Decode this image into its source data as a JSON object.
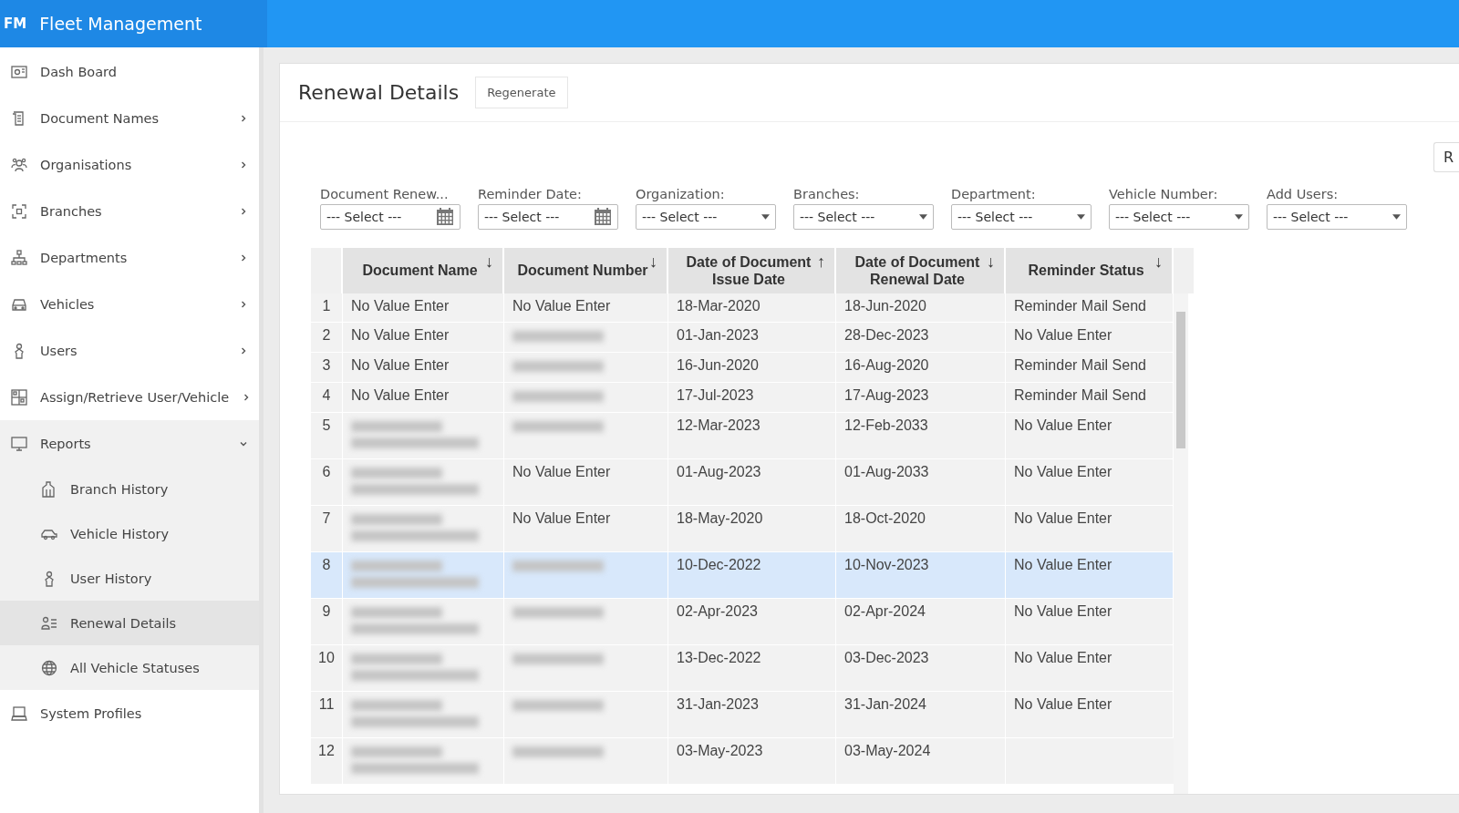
{
  "app": {
    "logo": "FM",
    "title": "Fleet Management"
  },
  "sidebar": {
    "items": [
      {
        "label": "Dash Board",
        "expandable": false,
        "expanded": false,
        "selected": false
      },
      {
        "label": "Document Names",
        "expandable": true,
        "expanded": false,
        "selected": false
      },
      {
        "label": "Organisations",
        "expandable": true,
        "expanded": false,
        "selected": false
      },
      {
        "label": "Branches",
        "expandable": true,
        "expanded": false,
        "selected": false
      },
      {
        "label": "Departments",
        "expandable": true,
        "expanded": false,
        "selected": false
      },
      {
        "label": "Vehicles",
        "expandable": true,
        "expanded": false,
        "selected": false
      },
      {
        "label": "Users",
        "expandable": true,
        "expanded": false,
        "selected": false
      },
      {
        "label": "Assign/Retrieve User/Vehicle",
        "expandable": true,
        "expanded": false,
        "selected": false
      },
      {
        "label": "Reports",
        "expandable": true,
        "expanded": true,
        "selected": false,
        "children": [
          {
            "label": "Branch History",
            "selected": false
          },
          {
            "label": "Vehicle History",
            "selected": false
          },
          {
            "label": "User History",
            "selected": false
          },
          {
            "label": "Renewal Details",
            "selected": true
          },
          {
            "label": "All Vehicle Statuses",
            "selected": false
          }
        ]
      },
      {
        "label": "System Profiles",
        "expandable": false,
        "expanded": false,
        "selected": false
      }
    ]
  },
  "page": {
    "title": "Renewal Details",
    "regenerate_button": "Regenerate",
    "right_button": "R"
  },
  "filters": [
    {
      "label": "Document Renew...",
      "placeholder": "--- Select ---",
      "kind": "date"
    },
    {
      "label": "Reminder Date:",
      "placeholder": "--- Select ---",
      "kind": "date"
    },
    {
      "label": "Organization:",
      "placeholder": "--- Select ---",
      "kind": "select"
    },
    {
      "label": "Branches:",
      "placeholder": "--- Select ---",
      "kind": "select"
    },
    {
      "label": "Department:",
      "placeholder": "--- Select ---",
      "kind": "select"
    },
    {
      "label": "Vehicle Number:",
      "placeholder": "--- Select ---",
      "kind": "select"
    },
    {
      "label": "Add Users:",
      "placeholder": "--- Select ---",
      "kind": "select"
    }
  ],
  "table": {
    "columns": [
      {
        "label": "Document Name",
        "sort": "↓"
      },
      {
        "label": "Document Number",
        "sort": "↓"
      },
      {
        "label": "Date of Document Issue Date",
        "sort": "↑"
      },
      {
        "label": "Date of Document Renewal Date",
        "sort": "↓"
      },
      {
        "label": "Reminder Status",
        "sort": "↓"
      }
    ],
    "rows": [
      {
        "index": "1",
        "selected": false,
        "cells": [
          "No Value Enter",
          "No Value Enter",
          "18-Mar-2020",
          "18-Jun-2020",
          "Reminder Mail Send"
        ]
      },
      {
        "index": "2",
        "selected": false,
        "cells": [
          "No Value Enter",
          {
            "kind": "redacted"
          },
          "01-Jan-2023",
          "28-Dec-2023",
          "No Value Enter"
        ]
      },
      {
        "index": "3",
        "selected": false,
        "cells": [
          "No Value Enter",
          {
            "kind": "redacted"
          },
          "16-Jun-2020",
          "16-Aug-2020",
          "Reminder Mail Send"
        ]
      },
      {
        "index": "4",
        "selected": false,
        "cells": [
          "No Value Enter",
          {
            "kind": "redacted"
          },
          "17-Jul-2023",
          "17-Aug-2023",
          "Reminder Mail Send"
        ]
      },
      {
        "index": "5",
        "selected": false,
        "cells": [
          {
            "kind": "redacted"
          },
          {
            "kind": "redacted"
          },
          "12-Mar-2023",
          "12-Feb-2033",
          "No Value Enter"
        ]
      },
      {
        "index": "6",
        "selected": false,
        "cells": [
          {
            "kind": "redacted"
          },
          "No Value Enter",
          "01-Aug-2023",
          "01-Aug-2033",
          "No Value Enter"
        ]
      },
      {
        "index": "7",
        "selected": false,
        "cells": [
          {
            "kind": "redacted"
          },
          "No Value Enter",
          "18-May-2020",
          "18-Oct-2020",
          "No Value Enter"
        ]
      },
      {
        "index": "8",
        "selected": true,
        "cells": [
          {
            "kind": "redacted"
          },
          {
            "kind": "redacted"
          },
          "10-Dec-2022",
          "10-Nov-2023",
          "No Value Enter"
        ]
      },
      {
        "index": "9",
        "selected": false,
        "cells": [
          {
            "kind": "redacted"
          },
          {
            "kind": "redacted"
          },
          "02-Apr-2023",
          "02-Apr-2024",
          "No Value Enter"
        ]
      },
      {
        "index": "10",
        "selected": false,
        "cells": [
          {
            "kind": "redacted"
          },
          {
            "kind": "redacted"
          },
          "13-Dec-2022",
          "03-Dec-2023",
          "No Value Enter"
        ]
      },
      {
        "index": "11",
        "selected": false,
        "cells": [
          {
            "kind": "redacted"
          },
          {
            "kind": "redacted"
          },
          "31-Jan-2023",
          "31-Jan-2024",
          "No Value Enter"
        ]
      },
      {
        "index": "12",
        "selected": false,
        "cells": [
          {
            "kind": "redacted"
          },
          {
            "kind": "redacted"
          },
          "03-May-2023",
          "03-May-2024"
        ]
      }
    ]
  }
}
